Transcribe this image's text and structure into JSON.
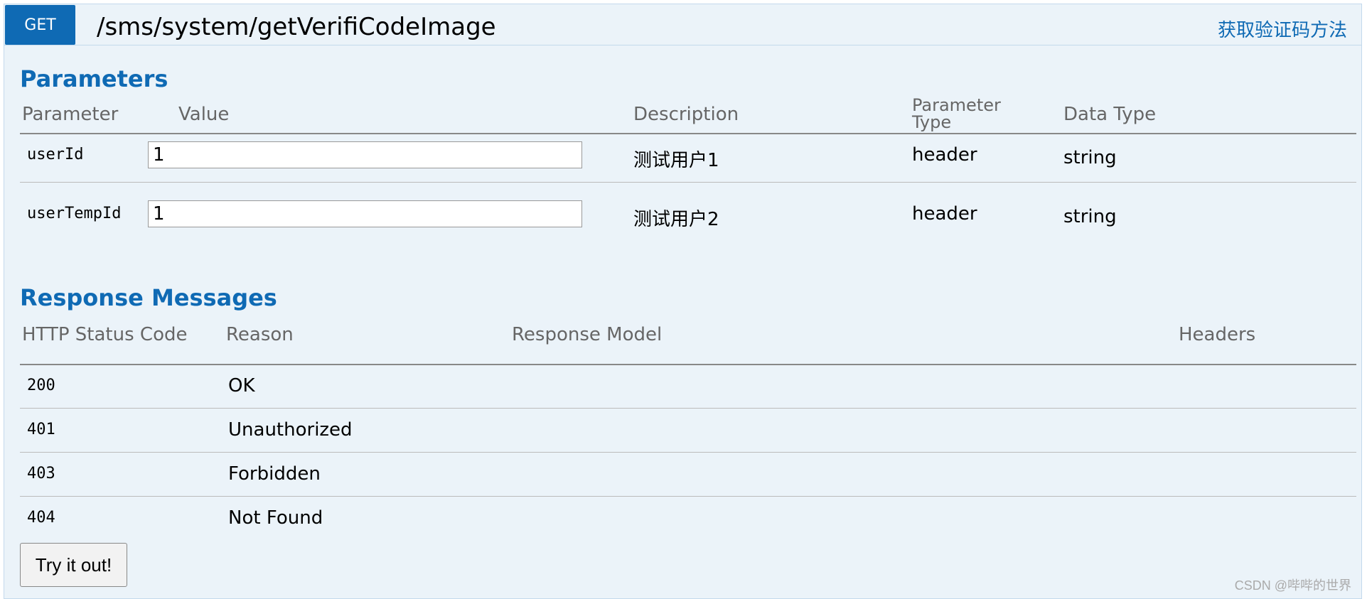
{
  "operation": {
    "method": "GET",
    "path": "/sms/system/getVerifiCodeImage",
    "summary": "获取验证码方法"
  },
  "parameters": {
    "title": "Parameters",
    "columns": [
      "Parameter",
      "Value",
      "Description",
      "Parameter Type",
      "Data Type"
    ],
    "rows": [
      {
        "name": "userId",
        "value": "1",
        "description": "测试用户1",
        "param_type": "header",
        "data_type": "string"
      },
      {
        "name": "userTempId",
        "value": "1",
        "description": "测试用户2",
        "param_type": "header",
        "data_type": "string"
      }
    ]
  },
  "responses": {
    "title": "Response Messages",
    "columns": [
      "HTTP Status Code",
      "Reason",
      "Response Model",
      "Headers"
    ],
    "rows": [
      {
        "code": "200",
        "reason": "OK"
      },
      {
        "code": "401",
        "reason": "Unauthorized"
      },
      {
        "code": "403",
        "reason": "Forbidden"
      },
      {
        "code": "404",
        "reason": "Not Found"
      }
    ]
  },
  "try_button": "Try it out!",
  "watermark": "CSDN @哔哔的世界",
  "colors": {
    "accent": "#0f6ab4",
    "panel_bg": "#ebf3f9",
    "panel_border": "#c3d9ec"
  }
}
